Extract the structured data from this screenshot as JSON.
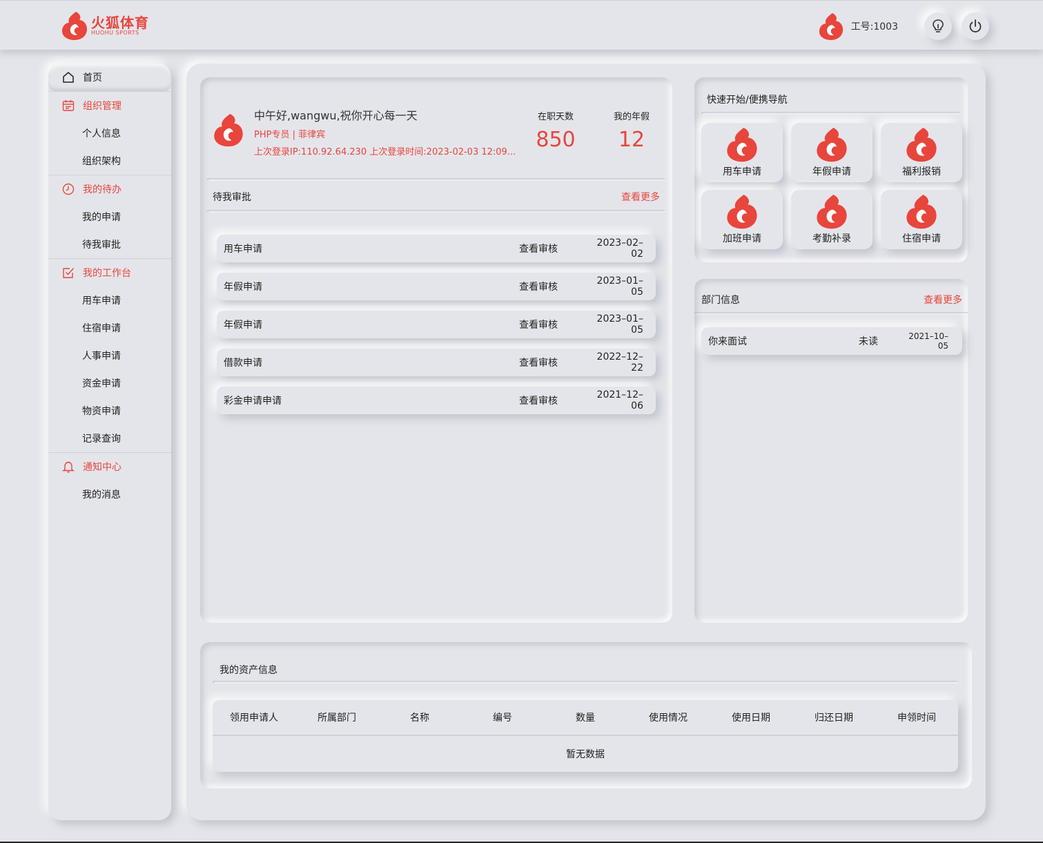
{
  "header": {
    "brand_cn": "火狐体育",
    "brand_en": "HUOHU SPORTS",
    "employee_id": "工号:1003"
  },
  "sidebar": {
    "home": "首页",
    "groups": [
      {
        "title": "组织管理",
        "icon": "calendar-icon",
        "items": [
          "个人信息",
          "组织架构"
        ]
      },
      {
        "title": "我的待办",
        "icon": "clock-icon",
        "items": [
          "我的申请",
          "待我审批"
        ]
      },
      {
        "title": "我的工作台",
        "icon": "checkbox-icon",
        "items": [
          "用车申请",
          "住宿申请",
          "人事申请",
          "资金申请",
          "物资申请",
          "记录查询"
        ]
      },
      {
        "title": "通知中心",
        "icon": "bell-icon",
        "items": [
          "我的消息"
        ]
      }
    ]
  },
  "welcome": {
    "greeting": "中午好,wangwu,祝你开心每一天",
    "role": "PHP专员 | 菲律宾",
    "last_login": "上次登录IP:110.92.64.230 上次登录时间:2023-02-03 12:09...",
    "stats": [
      {
        "label": "在职天数",
        "value": "850"
      },
      {
        "label": "我的年假",
        "value": "12"
      }
    ]
  },
  "approvals": {
    "title": "待我审批",
    "more": "查看更多",
    "rows": [
      {
        "name": "用车申请",
        "action": "查看审核",
        "date": "2023–02–02"
      },
      {
        "name": "年假申请",
        "action": "查看审核",
        "date": "2023–01–05"
      },
      {
        "name": "年假申请",
        "action": "查看审核",
        "date": "2023–01–05"
      },
      {
        "name": "借款申请",
        "action": "查看审核",
        "date": "2022–12–22"
      },
      {
        "name": "彩金申请申请",
        "action": "查看审核",
        "date": "2021–12–06"
      }
    ]
  },
  "quick": {
    "title": "快速开始/便携导航",
    "tiles": [
      "用车申请",
      "年假申请",
      "福利报销",
      "加班申请",
      "考勤补录",
      "住宿申请"
    ]
  },
  "dept": {
    "title": "部门信息",
    "more": "查看更多",
    "rows": [
      {
        "name": "你来面试",
        "status": "未读",
        "date": "2021–10–05"
      }
    ]
  },
  "assets": {
    "title": "我的资产信息",
    "columns": [
      "领用申请人",
      "所属部门",
      "名称",
      "编号",
      "数量",
      "使用情况",
      "使用日期",
      "归还日期",
      "申领时间"
    ],
    "empty": "暂无数据"
  },
  "colors": {
    "accent": "#e8453c",
    "background": "#e4e5ea"
  }
}
